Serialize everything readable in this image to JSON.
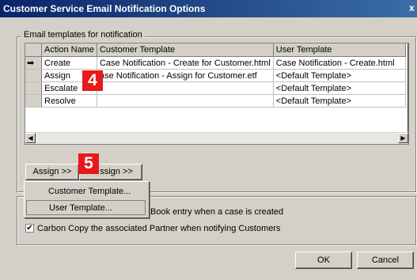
{
  "window": {
    "title": "Customer Service Email Notification Options",
    "close_glyph": "x"
  },
  "group": {
    "label": "Email templates for notification"
  },
  "grid": {
    "columns": [
      "Action Name",
      "Customer Template",
      "User Template"
    ],
    "rows": [
      {
        "marker": "➡",
        "action": "Create",
        "customer": "Case Notification - Create for Customer.html",
        "user": "Case Notification - Create.html"
      },
      {
        "marker": "",
        "action": "Assign",
        "customer": "ase Notification - Assign for Customer.etf",
        "user": "<Default Template>"
      },
      {
        "marker": "",
        "action": "Escalate",
        "customer": "",
        "user": "<Default Template>"
      },
      {
        "marker": "",
        "action": "Resolve",
        "customer": "",
        "user": "<Default Template>"
      }
    ]
  },
  "buttons": {
    "assign1": "Assign >>",
    "assign2": "ssign >>",
    "ok": "OK",
    "cancel": "Cancel"
  },
  "badges": {
    "step4": "4",
    "step5": "5"
  },
  "context_menu": {
    "customer": "Customer Template...",
    "user": "User Template..."
  },
  "options": {
    "book_entry_text": "Book entry when a case is created",
    "carbon_copy_label": "Carbon Copy the associated Partner when notifying Customers",
    "carbon_copy_checked": true
  },
  "icons": {
    "row_marker": "arrow-right-icon",
    "scroll_left": "triangle-left-icon",
    "scroll_right": "triangle-right-icon"
  }
}
